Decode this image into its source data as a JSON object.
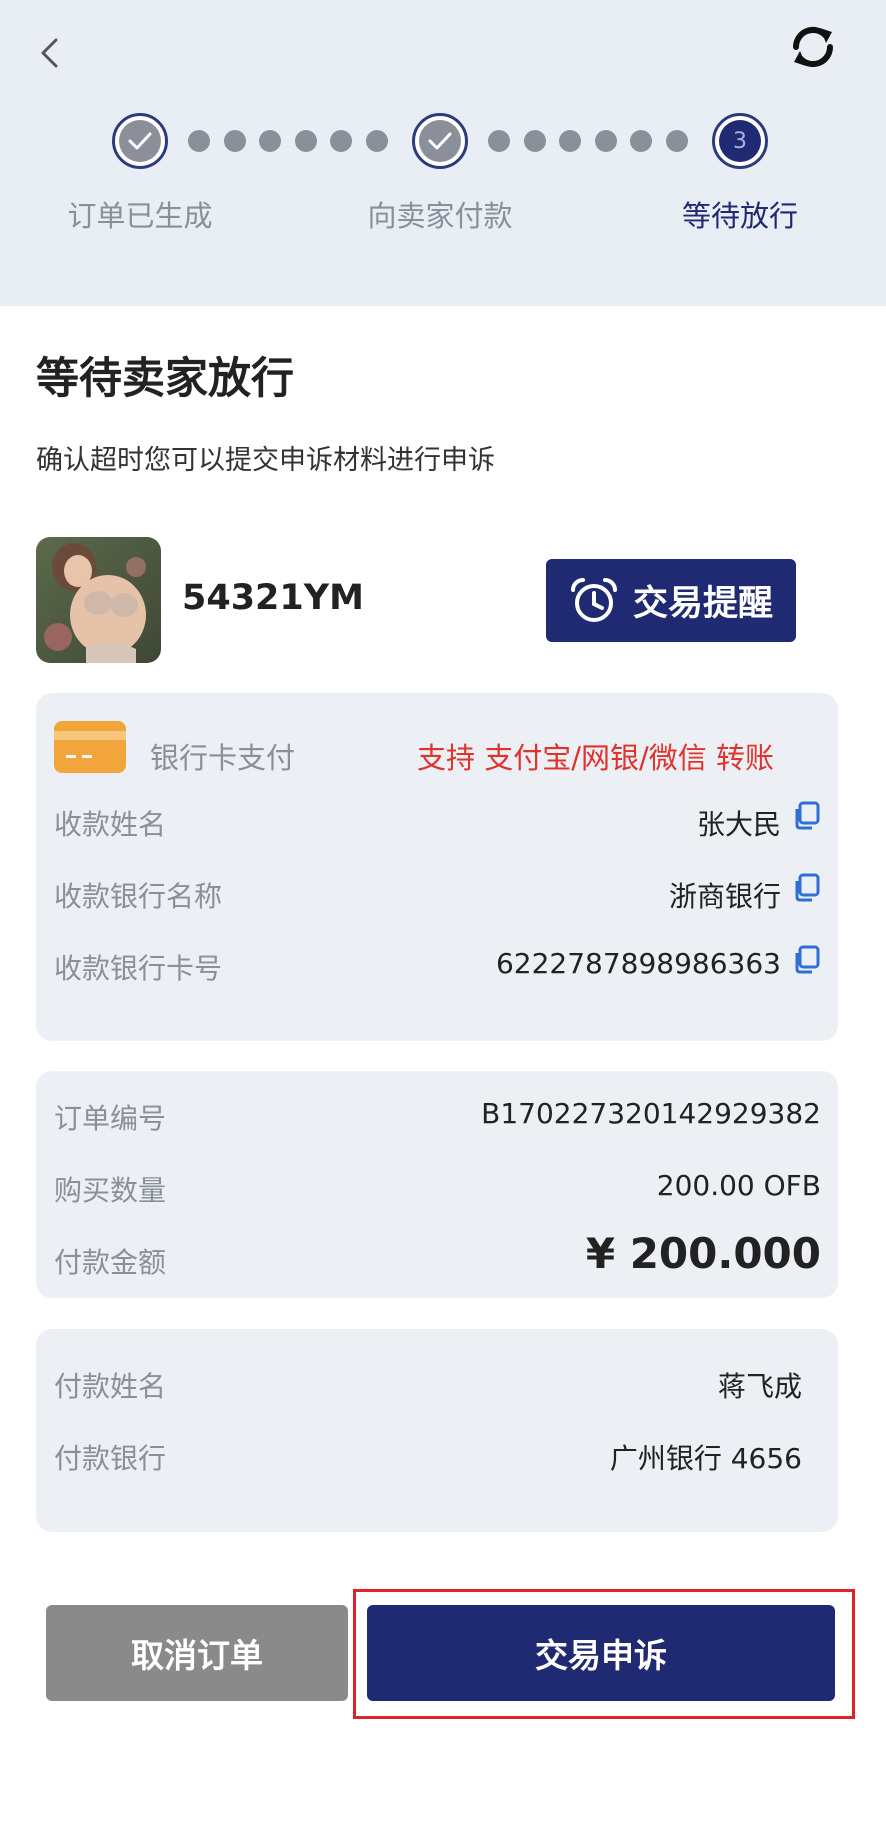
{
  "header": {
    "back_icon": "chevron-left-icon",
    "refresh_icon": "refresh-icon",
    "steps": [
      {
        "label": "订单已生成",
        "state": "done"
      },
      {
        "label": "向卖家付款",
        "state": "done"
      },
      {
        "label": "等待放行",
        "state": "active",
        "number": "3"
      }
    ]
  },
  "main": {
    "title": "等待卖家放行",
    "subtitle": "确认超时您可以提交申诉材料进行申诉"
  },
  "seller": {
    "name": "54321YM",
    "remind_button": "交易提醒"
  },
  "payment": {
    "method_label": "银行卡支付",
    "support_text": "支持 支付宝/网银/微信 转账",
    "rows": [
      {
        "label": "收款姓名",
        "value": "张大民"
      },
      {
        "label": "收款银行名称",
        "value": "浙商银行"
      },
      {
        "label": "收款银行卡号",
        "value": "6222787898986363"
      }
    ]
  },
  "order": {
    "rows": [
      {
        "label": "订单编号",
        "value": "B170227320142929382"
      },
      {
        "label": "购买数量",
        "value": "200.00 OFB"
      },
      {
        "label": "付款金额",
        "value": "¥  200.000"
      }
    ]
  },
  "payer": {
    "rows": [
      {
        "label": "付款姓名",
        "value": "蒋飞成"
      },
      {
        "label": "付款银行",
        "value": "广州银行 4656"
      }
    ]
  },
  "actions": {
    "cancel": "取消订单",
    "appeal": "交易申诉"
  },
  "colors": {
    "primary": "#1f2a72",
    "header_bg": "#e9edf4",
    "card_bg": "#eceff4",
    "warning_red": "#e0332b",
    "muted": "#8a8f99"
  }
}
